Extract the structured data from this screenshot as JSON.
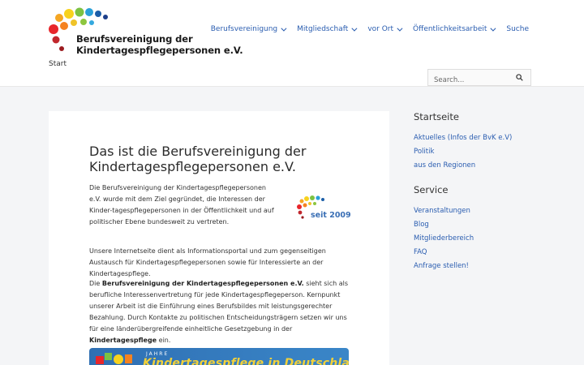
{
  "logo": {
    "line1": "Berufsvereinigung der",
    "line2": "Kindertagespflegepersonen e.V."
  },
  "nav": {
    "items": [
      {
        "label": "Berufsvereinigung",
        "dropdown": true
      },
      {
        "label": "Mitgliedschaft",
        "dropdown": true
      },
      {
        "label": "vor Ort",
        "dropdown": true
      },
      {
        "label": "Öffentlichkeitsarbeit",
        "dropdown": true
      },
      {
        "label": "Suche",
        "dropdown": false
      }
    ]
  },
  "breadcrumb": "Start",
  "search": {
    "placeholder": "Search..."
  },
  "article": {
    "title": "Das ist die Berufsvereinigung der Kindertagespflegepersonen e.V.",
    "p1": "Die Berufsvereinigung der Kindertagespflegepersonen e.V. wurde mit dem Ziel gegründet, die Interessen der Kinder-tagespflegepersonen in der Öffentlichkeit und auf politischer Ebene bundesweit zu vertreten.",
    "since": "seit 2009",
    "p2": "Unsere Internetseite dient als Informationsportal und zum gegenseitigen Austausch für Kindertagespflegepersonen sowie für Interessierte an der Kindertagespflege.",
    "p3_pre": "Die ",
    "p3_bold1": "Berufsvereinigung der Kindertagespflegepersonen e.V.",
    "p3_mid": " sieht sich als berufliche Interessenvertretung für jede Kindertagespflegeperson. Kernpunkt unserer Arbeit ist die Einführung eines Berufsbildes mit leistungsgerechter Bezahlung. Durch Kontakte zu politischen Entscheidungsträgern setzen wir uns für eine länderübergreifende einheitliche Gesetzgebung in der ",
    "p3_bold2": "Kindertagespflege",
    "p3_post": " ein.",
    "banner_small": "JAHRE",
    "banner_text": "Kindertagespflege in Deutschland"
  },
  "sidebar": {
    "heading1": "Startseite",
    "links1": [
      "Aktuelles (Infos der BvK e.V)",
      "Politik",
      "aus den Regionen"
    ],
    "heading2": "Service",
    "links2": [
      "Veranstaltungen",
      "Blog",
      "Mitgliederbereich",
      "FAQ",
      "Anfrage stellen!"
    ]
  },
  "colors": {
    "link": "#2a5db0",
    "background": "#f4f5f7",
    "accent_blue": "#3a6fb5"
  },
  "icons": [
    "chevron-down-icon",
    "search-icon",
    "logo-dots"
  ]
}
